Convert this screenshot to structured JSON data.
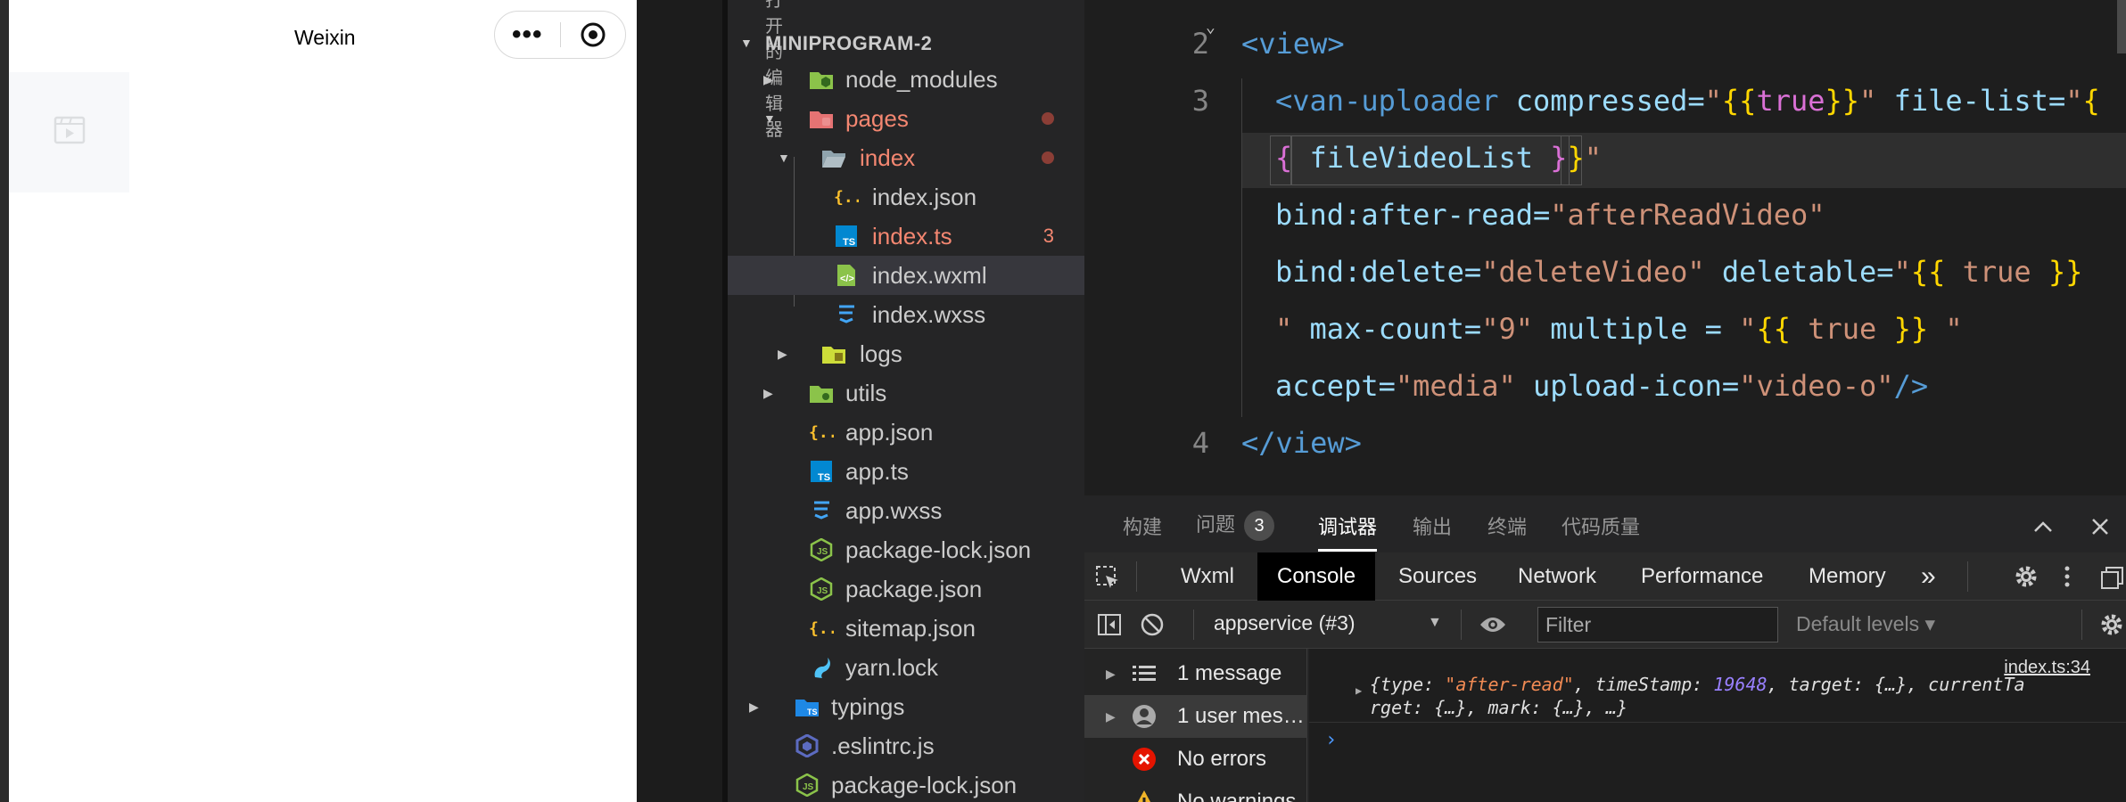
{
  "simulator": {
    "title": "Weixin",
    "capsule_more": "•••"
  },
  "explorer": {
    "partial_header": "打开的编辑器",
    "project_name": "MINIPROGRAM-2",
    "items": [
      {
        "name": "node_modules",
        "icon": "folder-node-icon",
        "color": "#cccccc"
      },
      {
        "name": "pages",
        "icon": "folder-pages-icon",
        "color": "#f48771"
      },
      {
        "name": "index",
        "icon": "folder-open-icon",
        "color": "#f48771"
      },
      {
        "name": "index.json",
        "icon": "json-file-icon",
        "color": "#cccccc"
      },
      {
        "name": "index.ts",
        "icon": "ts-file-icon",
        "color": "#f48771",
        "badge": "3"
      },
      {
        "name": "index.wxml",
        "icon": "wxml-file-icon",
        "color": "#cccccc"
      },
      {
        "name": "index.wxss",
        "icon": "css-file-icon",
        "color": "#cccccc"
      },
      {
        "name": "logs",
        "icon": "folder-logs-icon",
        "color": "#cccccc"
      },
      {
        "name": "utils",
        "icon": "folder-utils-icon",
        "color": "#cccccc"
      },
      {
        "name": "app.json",
        "icon": "json-file-icon",
        "color": "#cccccc"
      },
      {
        "name": "app.ts",
        "icon": "ts-file-icon",
        "color": "#cccccc"
      },
      {
        "name": "app.wxss",
        "icon": "css-file-icon",
        "color": "#cccccc"
      },
      {
        "name": "package-lock.json",
        "icon": "node-file-icon",
        "color": "#cccccc"
      },
      {
        "name": "package.json",
        "icon": "node-file-icon",
        "color": "#cccccc"
      },
      {
        "name": "sitemap.json",
        "icon": "json-file-icon",
        "color": "#cccccc"
      },
      {
        "name": "yarn.lock",
        "icon": "yarn-file-icon",
        "color": "#cccccc"
      },
      {
        "name": "typings",
        "icon": "folder-typings-icon",
        "color": "#cccccc"
      },
      {
        "name": ".eslintrc.js",
        "icon": "eslint-file-icon",
        "color": "#cccccc"
      },
      {
        "name": "package-lock.json",
        "icon": "node-file-icon",
        "color": "#cccccc"
      }
    ]
  },
  "editor": {
    "line_numbers": [
      "2",
      "3",
      "4"
    ],
    "tokens": {
      "view_open": "<view>",
      "van_tag": "<van-uploader",
      "compressed_attr": " compressed=",
      "q1": "\"",
      "ob1": "{{",
      "true1": "true",
      "cb1": "}}",
      "q2": "\"",
      "filelist_attr": " file-list=",
      "q3": "\"",
      "ob2a": "{",
      "ob2b": "{",
      "fvl": " fileVideoList ",
      "cb2a": "}",
      "cb2b": "}",
      "q4": "\"",
      "afterread_attr": "bind:after-read=",
      "afterread_val": "\"afterReadVideo\"",
      "delete_attr": "bind:delete=",
      "delete_val": "\"deleteVideo\"",
      "deletable_attr": " deletable=",
      "q5": "\"",
      "ob3": "{{",
      "true3": " true ",
      "cb3": "}}",
      "q6": "\"",
      "maxcount_attr": " max-count=",
      "maxcount_val": "\"9\"",
      "multiple_attr": " multiple = ",
      "q7": "\"",
      "ob4": "{{",
      "true4": " true ",
      "cb4": "}}",
      "q8": " \"",
      "accept_attr": "accept=",
      "accept_val": "\"media\"",
      "uploadicon_attr": " upload-icon=",
      "uploadicon_val": "\"video-o\"",
      "selfclose": "/>",
      "view_close": "</view>"
    }
  },
  "panel": {
    "tabs": [
      {
        "label": "构建"
      },
      {
        "label": "问题",
        "count": "3"
      },
      {
        "label": "调试器"
      },
      {
        "label": "输出"
      },
      {
        "label": "终端"
      },
      {
        "label": "代码质量"
      }
    ],
    "devtools_tabs": [
      "Wxml",
      "Console",
      "Sources",
      "Network",
      "Performance",
      "Memory"
    ],
    "more_tabs": "»",
    "context": "appservice (#3)",
    "filter_placeholder": "Filter",
    "levels": "Default levels ▾",
    "sidebar": [
      {
        "label": "1 message"
      },
      {
        "label": "1 user mes…"
      },
      {
        "label": "No errors"
      },
      {
        "label": "No warnings"
      }
    ],
    "log": {
      "source": "index.ts:34",
      "l1_a": "{type: ",
      "l1_b": "\"after-read\"",
      "l1_c": ", timeStamp: ",
      "l1_d": "19648",
      "l1_e": ", target: {…}, currentTa",
      "l2": "rget: {…}, mark: {…}, …}",
      "prompt": "›"
    }
  },
  "colors": {
    "accent_blue": "#569cd6",
    "string": "#ce9178",
    "bracket": "#ffd700",
    "error_red": "#e51400",
    "warning_yellow": "#f0b429"
  }
}
